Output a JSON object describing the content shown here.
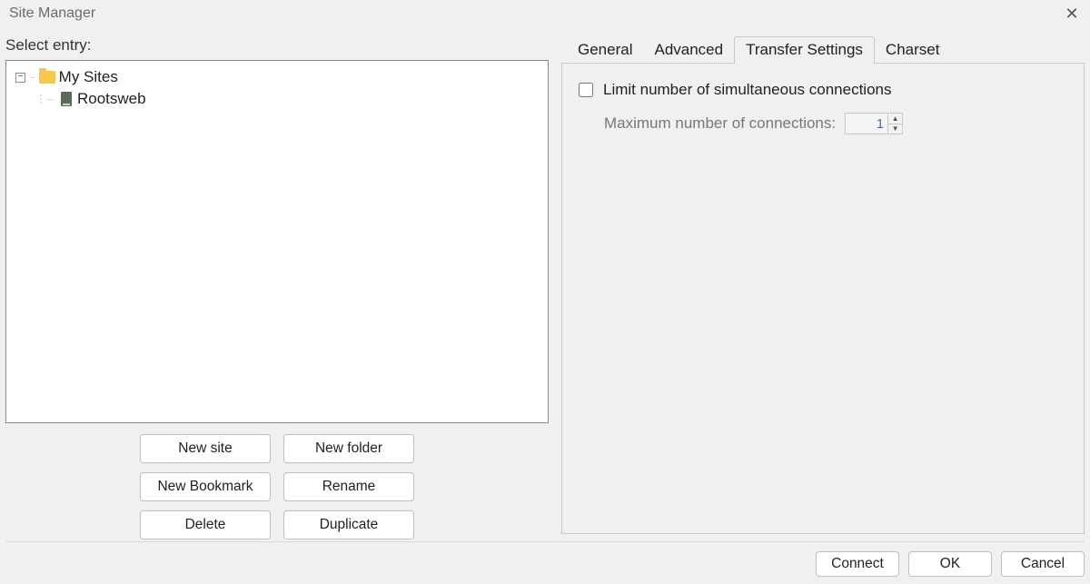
{
  "window": {
    "title": "Site Manager"
  },
  "left": {
    "select_label": "Select entry:",
    "tree": {
      "root_label": "My Sites",
      "child_label": "Rootsweb"
    },
    "buttons": {
      "new_site": "New site",
      "new_folder": "New folder",
      "new_bookmark": "New Bookmark",
      "rename": "Rename",
      "delete": "Delete",
      "duplicate": "Duplicate"
    }
  },
  "tabs": {
    "general": "General",
    "advanced": "Advanced",
    "transfer": "Transfer Settings",
    "charset": "Charset",
    "active": "transfer"
  },
  "transfer_panel": {
    "limit_label": "Limit number of simultaneous connections",
    "limit_checked": false,
    "max_label": "Maximum number of connections:",
    "max_value": "1"
  },
  "footer": {
    "connect": "Connect",
    "ok": "OK",
    "cancel": "Cancel"
  }
}
